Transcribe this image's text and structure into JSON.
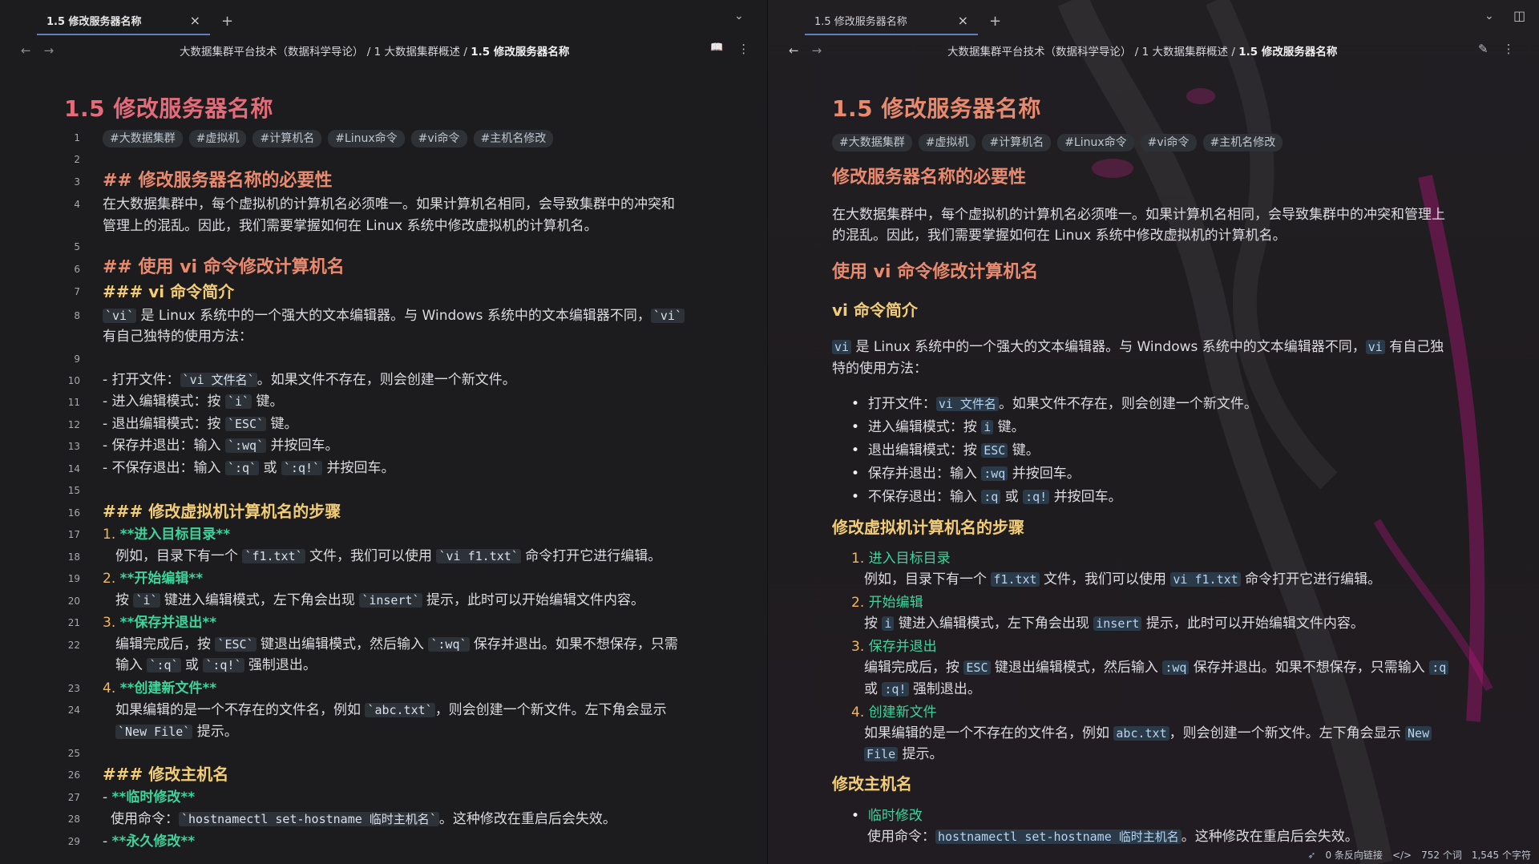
{
  "tab": {
    "label": "1.5 修改服务器名称",
    "close": "×",
    "new": "+",
    "menu": "⌄"
  },
  "breadcrumb": {
    "part1": "大数据集群平台技术（数据科学导论）",
    "sep": "/",
    "part2": "1 大数据集群概述",
    "part3": "1.5 修改服务器名称"
  },
  "nav": {
    "back": "←",
    "forward": "→",
    "book": "📖",
    "more": "⋮",
    "edit": "✎",
    "sidebar": "◫"
  },
  "doc": {
    "title": "1.5 修改服务器名称",
    "tags": [
      "#大数据集群",
      "#虚拟机",
      "#计算机名",
      "#Linux命令",
      "#vi命令",
      "#主机名修改"
    ],
    "h2_mark": "##",
    "h3_mark": "###",
    "h2_1": "修改服务器名称的必要性",
    "p1_a": "在大数据集群中，每个虚拟机的计算机名必须唯一。如果计算机名相同，会导致集群中的冲突和",
    "p1_b": "管理上的混乱。因此，我们需要掌握如何在 Linux 系统中修改虚拟机的计算机名。",
    "p1r_a": "在大数据集群中，每个虚拟机的计算机名必须唯一。如果计算机名相同，会导致集群中的冲突和管理上",
    "p1r_b": "的混乱。因此，我们需要掌握如何在 Linux 系统中修改虚拟机的计算机名。",
    "h2_2": "使用 vi 命令修改计算机名",
    "h3_1": "vi 命令简介",
    "vi": "vi",
    "p2_mid": " 是 Linux 系统中的一个强大的文本编辑器。与 Windows 系统中的文本编辑器不同，",
    "p2_end": "有自己独特的使用方法：",
    "p2r_end": " 有自己独",
    "p2r_b": "特的使用方法：",
    "li1_a": "打开文件：",
    "li1_code": "vi 文件名",
    "li1_b": "。如果文件不存在，则会创建一个新文件。",
    "li2_a": "进入编辑模式：按 ",
    "li2_code": "i",
    "li2_b": " 键。",
    "li3_a": "退出编辑模式：按 ",
    "li3_code": "ESC",
    "li3_b": " 键。",
    "li4_a": "保存并退出：输入 ",
    "li4_code": ":wq",
    "li4_b": " 并按回车。",
    "li5_a": "不保存退出：输入 ",
    "li5_code": ":q",
    "li5_or": " 或 ",
    "li5_code2": ":q!",
    "li5_b": " 并按回车。",
    "h3_2": "修改虚拟机计算机名的步骤",
    "s1": "进入目标目录",
    "s1_a": "例如，目录下有一个 ",
    "s1_code": "f1.txt",
    "s1_b": " 文件，我们可以使用 ",
    "s1_code2": "vi f1.txt",
    "s1_c": " 命令打开它进行编辑。",
    "s2": "开始编辑",
    "s2_a": "按 ",
    "s2_code": "i",
    "s2_b": " 键进入编辑模式，左下角会出现 ",
    "s2_code2": "insert",
    "s2_c": " 提示，此时可以开始编辑文件内容。",
    "s3": "保存并退出",
    "s3_a": "编辑完成后，按 ",
    "s3_code": "ESC",
    "s3_b": " 键退出编辑模式，然后输入 ",
    "s3_code2": ":wq",
    "s3_c": " 保存并退出。如果不想保存，只需",
    "s3_d": "输入 ",
    "s3_code3": ":q",
    "s3_or": " 或 ",
    "s3_code4": ":q!",
    "s3_e": " 强制退出。",
    "s3r_c": " 保存并退出。如果不想保存，只需输入 ",
    "s3r_d": "或 ",
    "s4": "创建新文件",
    "s4_a": "如果编辑的是一个不存在的文件名，例如 ",
    "s4_code": "abc.txt",
    "s4_b": "，则会创建一个新文件。左下角会显示",
    "s4_code2": "New File",
    "s4_c": " 提示。",
    "s4r_b": "，则会创建一个新文件。左下角会显示 ",
    "s4r_code2a": "New",
    "s4r_code2b": "File",
    "h3_3": "修改主机名",
    "t1": "临时修改",
    "t1_a": "使用命令：",
    "t1_code": "hostnamectl set-hostname 临时主机名",
    "t1_b": "。这种修改在重启后会失效。",
    "t2": "永久修改",
    "bold_mark": "**",
    "n1": "1.",
    "n2": "2.",
    "n3": "3.",
    "n4": "4.",
    "dash": "-",
    "bullet": "•",
    "tick": "`"
  },
  "line_numbers": [
    "1",
    "2",
    "3",
    "4",
    "5",
    "6",
    "7",
    "8",
    "9",
    "10",
    "11",
    "12",
    "13",
    "14",
    "15",
    "16",
    "17",
    "18",
    "19",
    "20",
    "21",
    "22",
    "23",
    "24",
    "25",
    "26",
    "27",
    "28",
    "29"
  ],
  "status": {
    "backlinks": "0 条反向链接",
    "code_icon": "</>",
    "words": "752 个词",
    "chars": "1,545 个字符"
  }
}
